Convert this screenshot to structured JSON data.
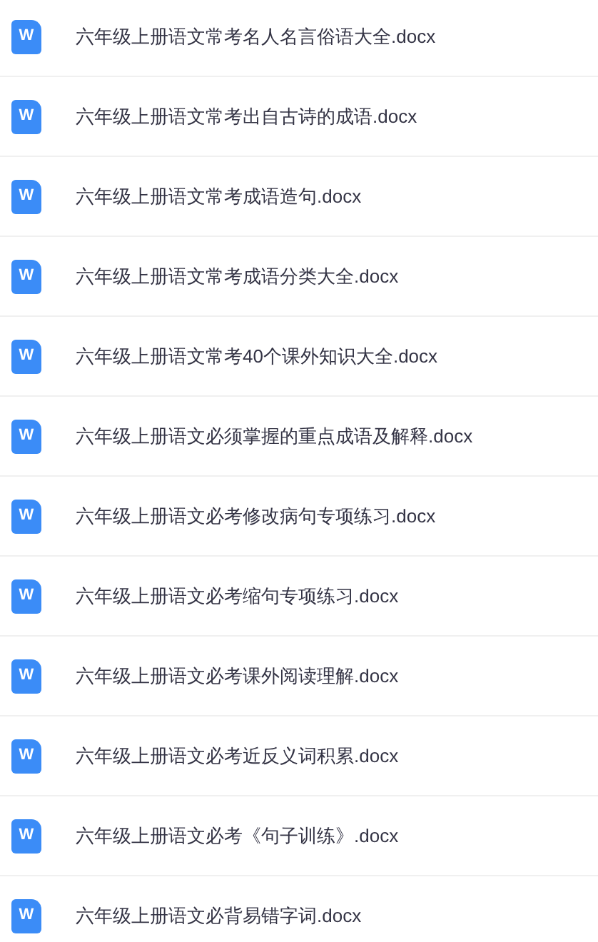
{
  "files": [
    {
      "icon": "W",
      "name": "六年级上册语文常考名人名言俗语大全.docx"
    },
    {
      "icon": "W",
      "name": "六年级上册语文常考出自古诗的成语.docx"
    },
    {
      "icon": "W",
      "name": "六年级上册语文常考成语造句.docx"
    },
    {
      "icon": "W",
      "name": "六年级上册语文常考成语分类大全.docx"
    },
    {
      "icon": "W",
      "name": "六年级上册语文常考40个课外知识大全.docx"
    },
    {
      "icon": "W",
      "name": "六年级上册语文必须掌握的重点成语及解释.docx"
    },
    {
      "icon": "W",
      "name": "六年级上册语文必考修改病句专项练习.docx"
    },
    {
      "icon": "W",
      "name": "六年级上册语文必考缩句专项练习.docx"
    },
    {
      "icon": "W",
      "name": "六年级上册语文必考课外阅读理解.docx"
    },
    {
      "icon": "W",
      "name": "六年级上册语文必考近反义词积累.docx"
    },
    {
      "icon": "W",
      "name": "六年级上册语文必考《句子训练》.docx"
    },
    {
      "icon": "W",
      "name": "六年级上册语文必背易错字词.docx"
    }
  ]
}
